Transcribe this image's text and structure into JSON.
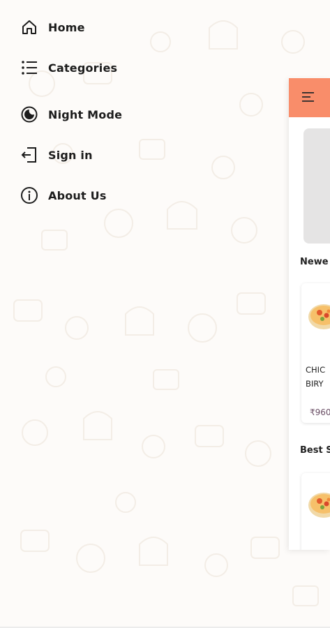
{
  "menu": {
    "items": [
      {
        "label": "Home",
        "icon": "home-icon"
      },
      {
        "label": "Categories",
        "icon": "list-icon"
      },
      {
        "label": "Night Mode",
        "icon": "night-mode-icon"
      },
      {
        "label": "Sign in",
        "icon": "sign-in-icon"
      },
      {
        "label": "About Us",
        "icon": "info-icon"
      }
    ]
  },
  "main": {
    "header_color": "#f98d6a",
    "sections": [
      {
        "title": "Newe"
      },
      {
        "title": "Best S"
      }
    ],
    "product": {
      "name": "CHIC\nBIRY",
      "price": "₹960"
    }
  },
  "colors": {
    "accent": "#f98d6a",
    "price": "#6b4f66"
  }
}
